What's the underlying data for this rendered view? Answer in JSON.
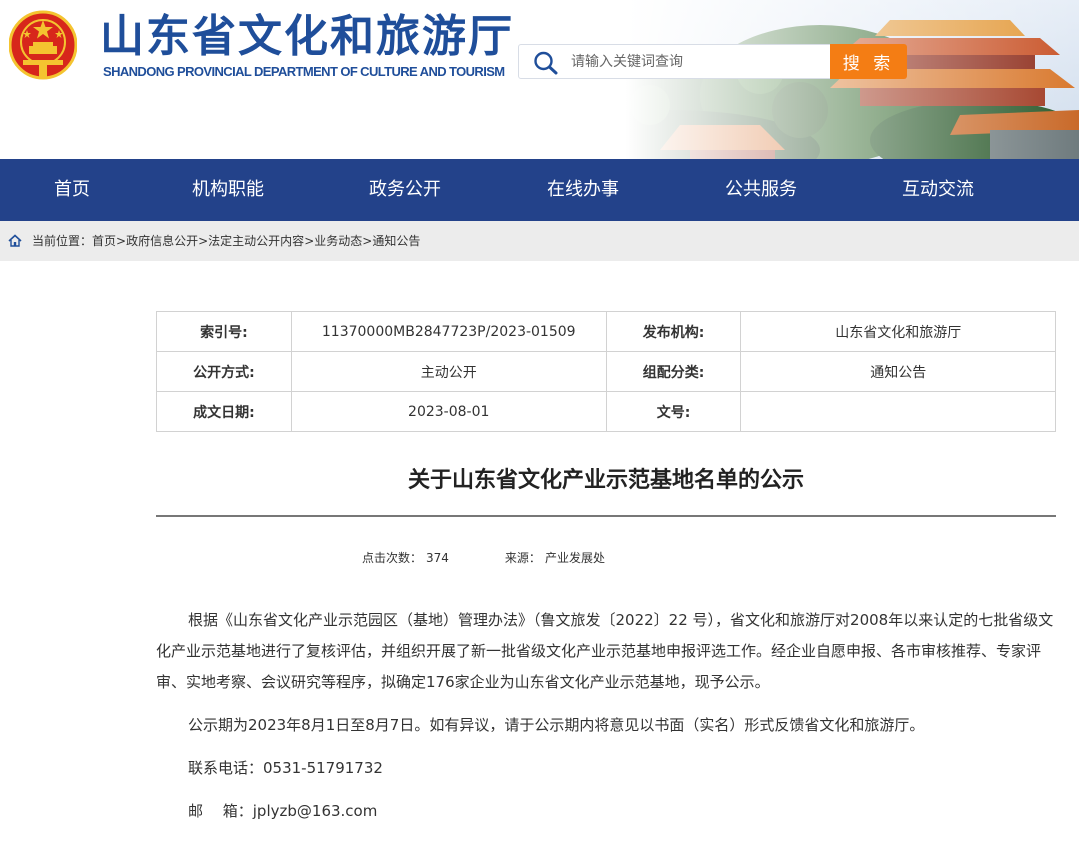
{
  "header": {
    "title_cn": "山东省文化和旅游厅",
    "title_en": "SHANDONG PROVINCIAL DEPARTMENT OF CULTURE AND TOURISM",
    "search_placeholder": "请输入关键词查询",
    "search_button": "搜 索"
  },
  "nav": {
    "items": [
      "首页",
      "机构职能",
      "政务公开",
      "在线办事",
      "公共服务",
      "互动交流"
    ]
  },
  "breadcrumb": {
    "label": "当前位置：",
    "items": [
      "首页",
      "政府信息公开",
      "法定主动公开内容",
      "业务动态",
      "通知公告"
    ]
  },
  "info_table": {
    "index_label": "索引号:",
    "index_value": "11370000MB2847723P/2023-01509",
    "publisher_label": "发布机构:",
    "publisher_value": "山东省文化和旅游厅",
    "open_mode_label": "公开方式:",
    "open_mode_value": "主动公开",
    "category_label": "组配分类:",
    "category_value": "通知公告",
    "date_label": "成文日期:",
    "date_value": "2023-08-01",
    "doc_no_label": "文号:",
    "doc_no_value": ""
  },
  "article": {
    "title": "关于山东省文化产业示范基地名单的公示",
    "views_label": "点击次数：",
    "views": "374",
    "source_label": "来源：",
    "source": "产业发展处",
    "paragraphs": [
      "根据《山东省文化产业示范园区（基地）管理办法》（鲁文旅发〔2022〕22 号），省文化和旅游厅对2008年以来认定的七批省级文化产业示范基地进行了复核评估，并组织开展了新一批省级文化产业示范基地申报评选工作。经企业自愿申报、各市审核推荐、专家评审、实地考察、会议研究等程序，拟确定176家企业为山东省文化产业示范基地，现予公示。",
      "公示期为2023年8月1日至8月7日。如有异议，请于公示期内将意见以书面（实名）形式反馈省文化和旅游厅。",
      "联系电话：0531-51791732",
      "邮　 箱：jplyzb@163.com"
    ]
  },
  "colors": {
    "brand_blue": "#1f4e9a",
    "nav_bg": "#23428a",
    "search_orange": "#f47d14",
    "emblem_red": "#d7261b",
    "emblem_gold": "#f4c430"
  }
}
